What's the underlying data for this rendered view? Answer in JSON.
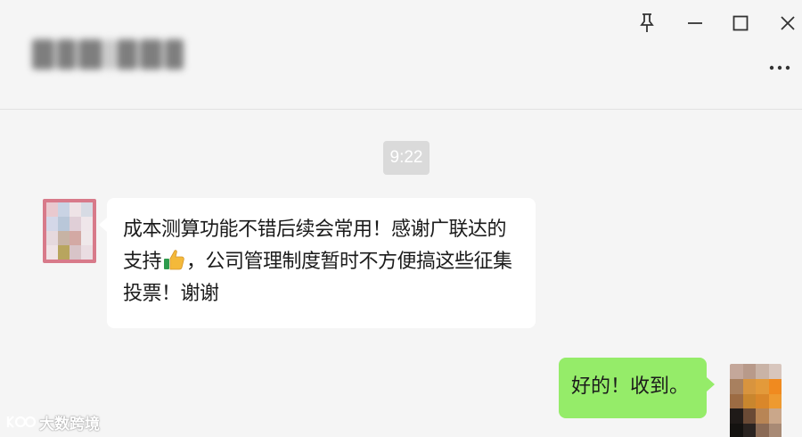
{
  "header": {
    "contact_name": "██·██"
  },
  "window_controls": {
    "pin": "pin-icon",
    "minimize": "minimize-icon",
    "maximize": "maximize-icon",
    "close": "close-icon",
    "more": "more-icon"
  },
  "chat": {
    "timestamp": "9:22",
    "messages": [
      {
        "direction": "incoming",
        "text_before_emoji": "成本测算功能不错后续会常用！感谢广联达的支持",
        "emoji": "thumbs-up-icon",
        "text_after_emoji": "，公司管理制度暂时不方便搞这些征集投票！谢谢"
      },
      {
        "direction": "outgoing",
        "text": "好的！收到。"
      }
    ]
  },
  "watermark": {
    "text": "大数跨境"
  },
  "colors": {
    "background": "#f5f5f5",
    "incoming_bubble": "#ffffff",
    "outgoing_bubble": "#95ec69",
    "timestamp_bg": "#dadada"
  }
}
